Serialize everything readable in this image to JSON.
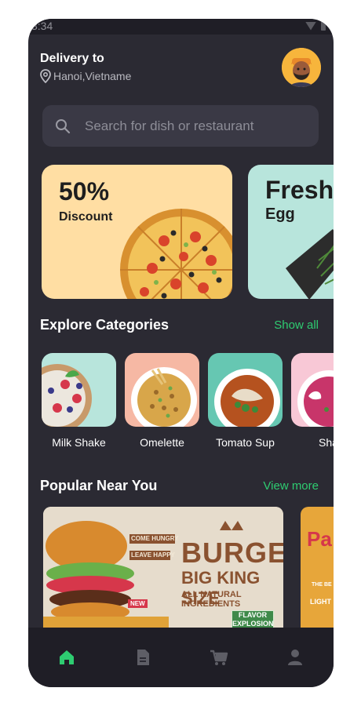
{
  "status": {
    "time": "3:34"
  },
  "header": {
    "delivery_title": "Delivery to",
    "location": "Hanoi,Vietname",
    "avatar_icon": "user-avatar"
  },
  "search": {
    "placeholder": "Search for dish or restaurant"
  },
  "promos": [
    {
      "headline": "50%",
      "subline": "Discount",
      "bg": "#ffdea3"
    },
    {
      "headline": "Fresh",
      "subline": "Egg",
      "bg": "#b8e5dc"
    }
  ],
  "categories_section": {
    "title": "Explore Categories",
    "link": "Show all",
    "items": [
      {
        "label": "Milk Shake",
        "bg": "#b8e5dc"
      },
      {
        "label": "Omelette",
        "bg": "#f6b8a4"
      },
      {
        "label": "Tomato Sup",
        "bg": "#66c7b2"
      },
      {
        "label": "Sha",
        "bg": "#f8c8d6"
      }
    ]
  },
  "popular_section": {
    "title": "Popular Near You",
    "link": "View more",
    "items": [
      {
        "headline": "BURGER",
        "line2": "BIG KING SIZE",
        "line3": "ALL NATURAL INGREDIENTS",
        "badge1": "COME HUNGRY",
        "badge2": "LEAVE HAPPY",
        "badge_new": "NEW",
        "flavor": "FLAVOR",
        "flavor2": "EXPLOSION"
      },
      {
        "headline": "Pa",
        "sub": "THE BE",
        "light": "LIGHT"
      }
    ]
  },
  "nav": {
    "items": [
      {
        "icon": "home-icon",
        "active": true
      },
      {
        "icon": "document-icon",
        "active": false
      },
      {
        "icon": "cart-icon",
        "active": false
      },
      {
        "icon": "profile-icon",
        "active": false
      }
    ]
  },
  "colors": {
    "background": "#2b2a33",
    "accent": "#2ecc71",
    "nav_bg": "#1f1e26"
  }
}
